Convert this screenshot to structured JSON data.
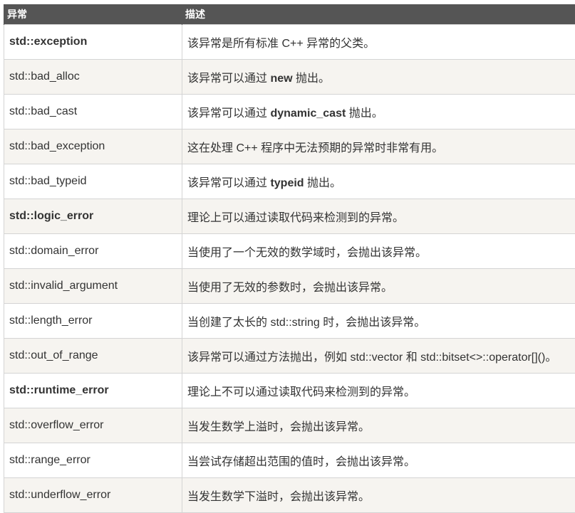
{
  "table": {
    "headers": [
      "异常",
      "描述"
    ],
    "rows": [
      {
        "name": "std::exception",
        "bold": true,
        "desc": [
          {
            "t": "该异常是所有标准 C++ 异常的父类。"
          }
        ]
      },
      {
        "name": "std::bad_alloc",
        "bold": false,
        "desc": [
          {
            "t": "该异常可以通过 "
          },
          {
            "t": "new",
            "b": true
          },
          {
            "t": " 抛出。"
          }
        ]
      },
      {
        "name": "std::bad_cast",
        "bold": false,
        "desc": [
          {
            "t": "该异常可以通过 "
          },
          {
            "t": "dynamic_cast",
            "b": true
          },
          {
            "t": " 抛出。"
          }
        ]
      },
      {
        "name": "std::bad_exception",
        "bold": false,
        "desc": [
          {
            "t": "这在处理 C++ 程序中无法预期的异常时非常有用。"
          }
        ]
      },
      {
        "name": "std::bad_typeid",
        "bold": false,
        "desc": [
          {
            "t": "该异常可以通过 "
          },
          {
            "t": "typeid",
            "b": true
          },
          {
            "t": " 抛出。"
          }
        ]
      },
      {
        "name": "std::logic_error",
        "bold": true,
        "desc": [
          {
            "t": "理论上可以通过读取代码来检测到的异常。"
          }
        ]
      },
      {
        "name": "std::domain_error",
        "bold": false,
        "desc": [
          {
            "t": "当使用了一个无效的数学域时，会抛出该异常。"
          }
        ]
      },
      {
        "name": "std::invalid_argument",
        "bold": false,
        "desc": [
          {
            "t": "当使用了无效的参数时，会抛出该异常。"
          }
        ]
      },
      {
        "name": "std::length_error",
        "bold": false,
        "desc": [
          {
            "t": "当创建了太长的 std::string 时，会抛出该异常。"
          }
        ]
      },
      {
        "name": "std::out_of_range",
        "bold": false,
        "desc": [
          {
            "t": "该异常可以通过方法抛出，例如 std::vector 和 std::bitset<>::operator[]()。"
          }
        ]
      },
      {
        "name": "std::runtime_error",
        "bold": true,
        "desc": [
          {
            "t": "理论上不可以通过读取代码来检测到的异常。"
          }
        ]
      },
      {
        "name": "std::overflow_error",
        "bold": false,
        "desc": [
          {
            "t": "当发生数学上溢时，会抛出该异常。"
          }
        ]
      },
      {
        "name": "std::range_error",
        "bold": false,
        "desc": [
          {
            "t": "当尝试存储超出范围的值时，会抛出该异常。"
          }
        ]
      },
      {
        "name": "std::underflow_error",
        "bold": false,
        "desc": [
          {
            "t": "当发生数学下溢时，会抛出该异常。"
          }
        ]
      }
    ]
  }
}
